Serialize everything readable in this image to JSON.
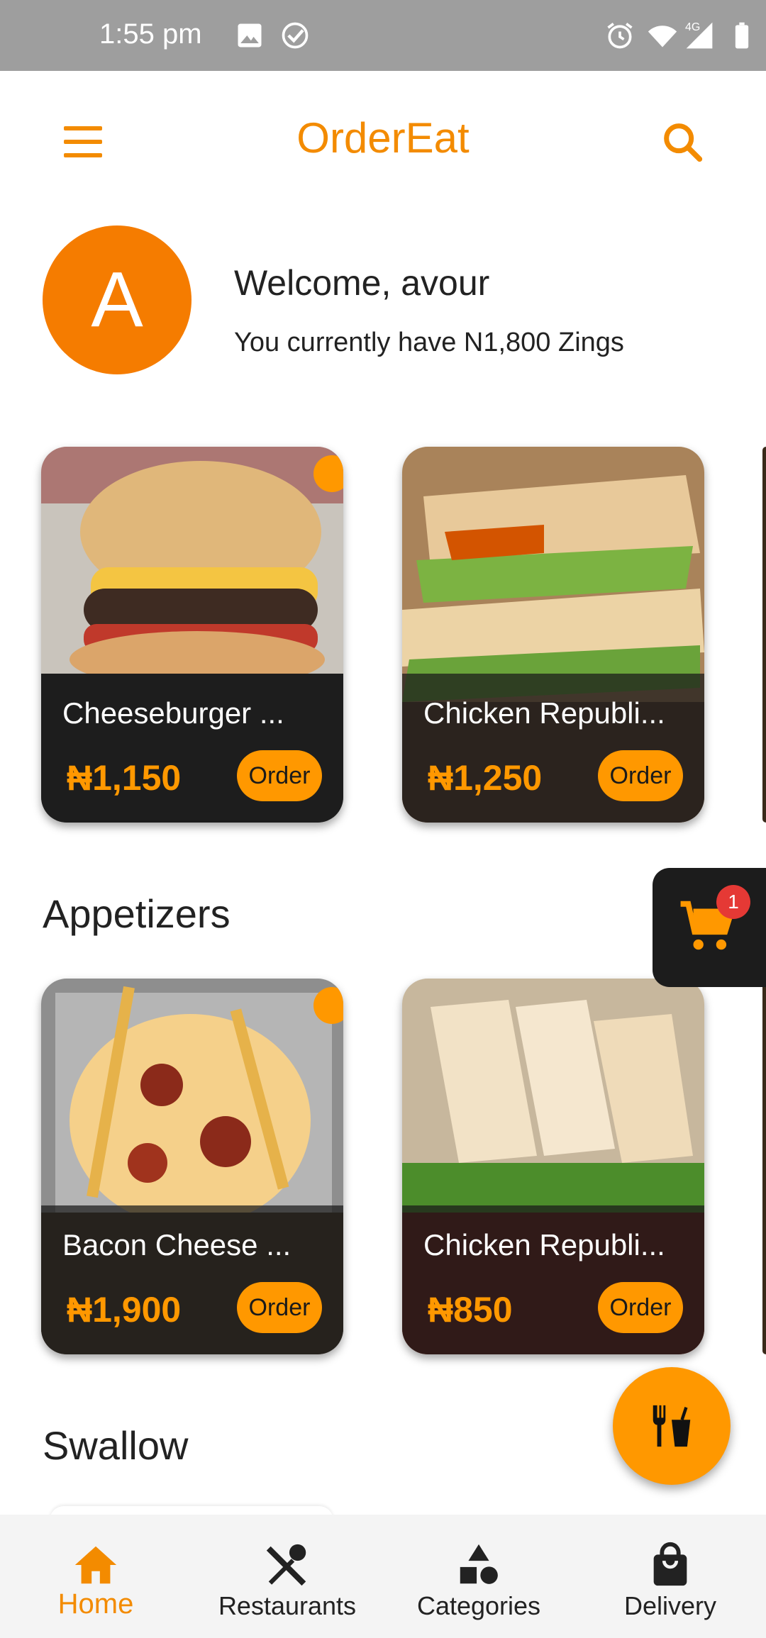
{
  "status_bar": {
    "time": "1:55 pm",
    "network": "4G"
  },
  "app_bar": {
    "title": "OrderEat"
  },
  "welcome": {
    "avatar_letter": "A",
    "greeting": "Welcome,  avour",
    "zings": "You currently have N1,800 Zings"
  },
  "featured": [
    {
      "name": "Cheeseburger ...",
      "price": "₦1,150",
      "order_label": "Order"
    },
    {
      "name": "Chicken Republi...",
      "price": "₦1,250",
      "order_label": "Order"
    }
  ],
  "appetizers": {
    "title": "Appetizers",
    "items": [
      {
        "name": "Bacon Cheese ...",
        "price": "₦1,900",
        "order_label": "Order"
      },
      {
        "name": "Chicken Republi...",
        "price": "₦850",
        "order_label": "Order"
      }
    ]
  },
  "swallow": {
    "title": "Swallow"
  },
  "cart": {
    "count": "1"
  },
  "bottom_nav": [
    {
      "label": "Home",
      "icon": "home-icon",
      "active": true
    },
    {
      "label": "Restaurants",
      "icon": "utensils-icon",
      "active": false
    },
    {
      "label": "Categories",
      "icon": "shapes-icon",
      "active": false
    },
    {
      "label": "Delivery",
      "icon": "bag-icon",
      "active": false
    }
  ],
  "colors": {
    "accent": "#f38b00",
    "order_button": "#ff9800",
    "badge": "#e53935"
  }
}
